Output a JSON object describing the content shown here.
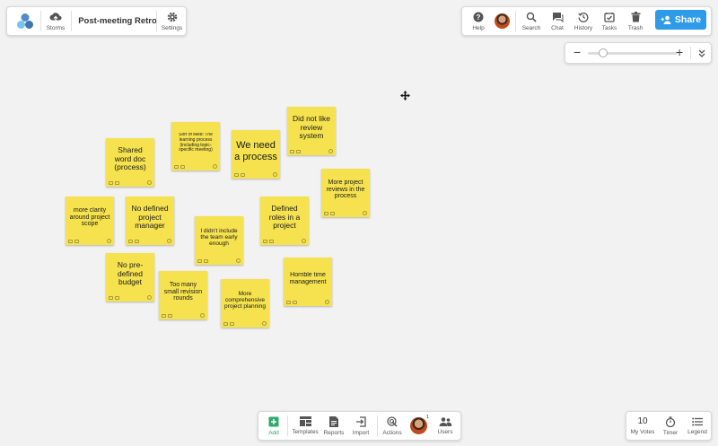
{
  "header_left": {
    "storms_label": "Storms",
    "board_title": "Post-meeting Retro",
    "settings_label": "Settings"
  },
  "header_right": {
    "help_label": "Help",
    "search_label": "Search",
    "chat_label": "Chat",
    "history_label": "History",
    "tasks_label": "Tasks",
    "trash_label": "Trash",
    "share_label": "Share"
  },
  "zoom": {
    "minus": "−",
    "plus": "+",
    "level": 0.12
  },
  "notes": [
    {
      "text": "Did not like review system"
    },
    {
      "text": "Sort of liked: The learning process (including topic-specific meeting)"
    },
    {
      "text": "We need a process"
    },
    {
      "text": "Shared word doc (process)"
    },
    {
      "text": "More project reviews in the process"
    },
    {
      "text": "more clarity around project scope"
    },
    {
      "text": "No defined project manager"
    },
    {
      "text": "Defined roles in a project"
    },
    {
      "text": "I didn't include the team early enough"
    },
    {
      "text": "No pre-defined budget"
    },
    {
      "text": "Horrible time management"
    },
    {
      "text": "Too many small revision rounds"
    },
    {
      "text": "More comprehensive project planning"
    }
  ],
  "bottom_toolbar": {
    "add_label": "Add",
    "templates_label": "Templates",
    "reports_label": "Reports",
    "import_label": "Import",
    "actions_label": "Actions",
    "users_label": "Users",
    "user_badge": "1"
  },
  "bottom_right": {
    "votes_count": "10",
    "votes_label": "My Votes",
    "timer_label": "Timer",
    "legend_label": "Legend"
  },
  "colors": {
    "note_yellow": "#f5e24e",
    "share_blue": "#2e9be8",
    "add_green": "#2daa6a"
  }
}
